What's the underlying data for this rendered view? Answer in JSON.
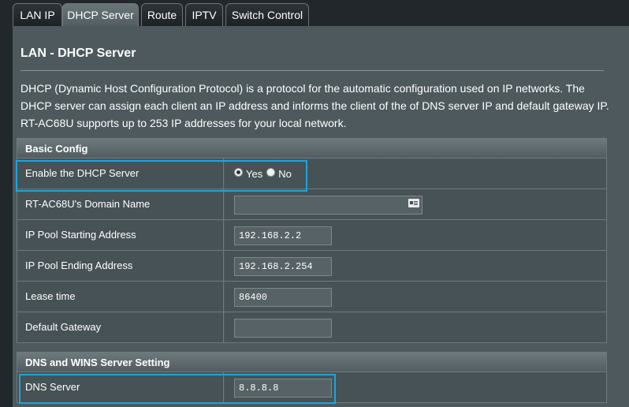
{
  "tabs": [
    {
      "label": "LAN IP",
      "active": false
    },
    {
      "label": "DHCP Server",
      "active": true
    },
    {
      "label": "Route",
      "active": false
    },
    {
      "label": "IPTV",
      "active": false
    },
    {
      "label": "Switch Control",
      "active": false
    }
  ],
  "page": {
    "title": "LAN - DHCP Server",
    "description": "DHCP (Dynamic Host Configuration Protocol) is a protocol for the automatic configuration used on IP networks. The DHCP server can assign each client an IP address and informs the client of the of DNS server IP and default gateway IP. RT-AC68U supports up to 253 IP addresses for your local network."
  },
  "basic_config": {
    "header": "Basic Config",
    "enable_dhcp": {
      "label": "Enable the DHCP Server",
      "yes_label": "Yes",
      "no_label": "No",
      "selected": "Yes"
    },
    "domain_name": {
      "label": "RT-AC68U's Domain Name",
      "value": ""
    },
    "pool_start": {
      "label": "IP Pool Starting Address",
      "value": "192.168.2.2"
    },
    "pool_end": {
      "label": "IP Pool Ending Address",
      "value": "192.168.2.254"
    },
    "lease_time": {
      "label": "Lease time",
      "value": "86400"
    },
    "default_gateway": {
      "label": "Default Gateway",
      "value": ""
    }
  },
  "dns_wins": {
    "header": "DNS and WINS Server Setting",
    "dns_server": {
      "label": "DNS Server",
      "value": "8.8.8.8"
    }
  },
  "colors": {
    "highlight": "#1aa6dc",
    "panel": "#4d595d",
    "background": "#21272b"
  },
  "icons": {
    "domain_field_icon": "contact-card-icon"
  }
}
